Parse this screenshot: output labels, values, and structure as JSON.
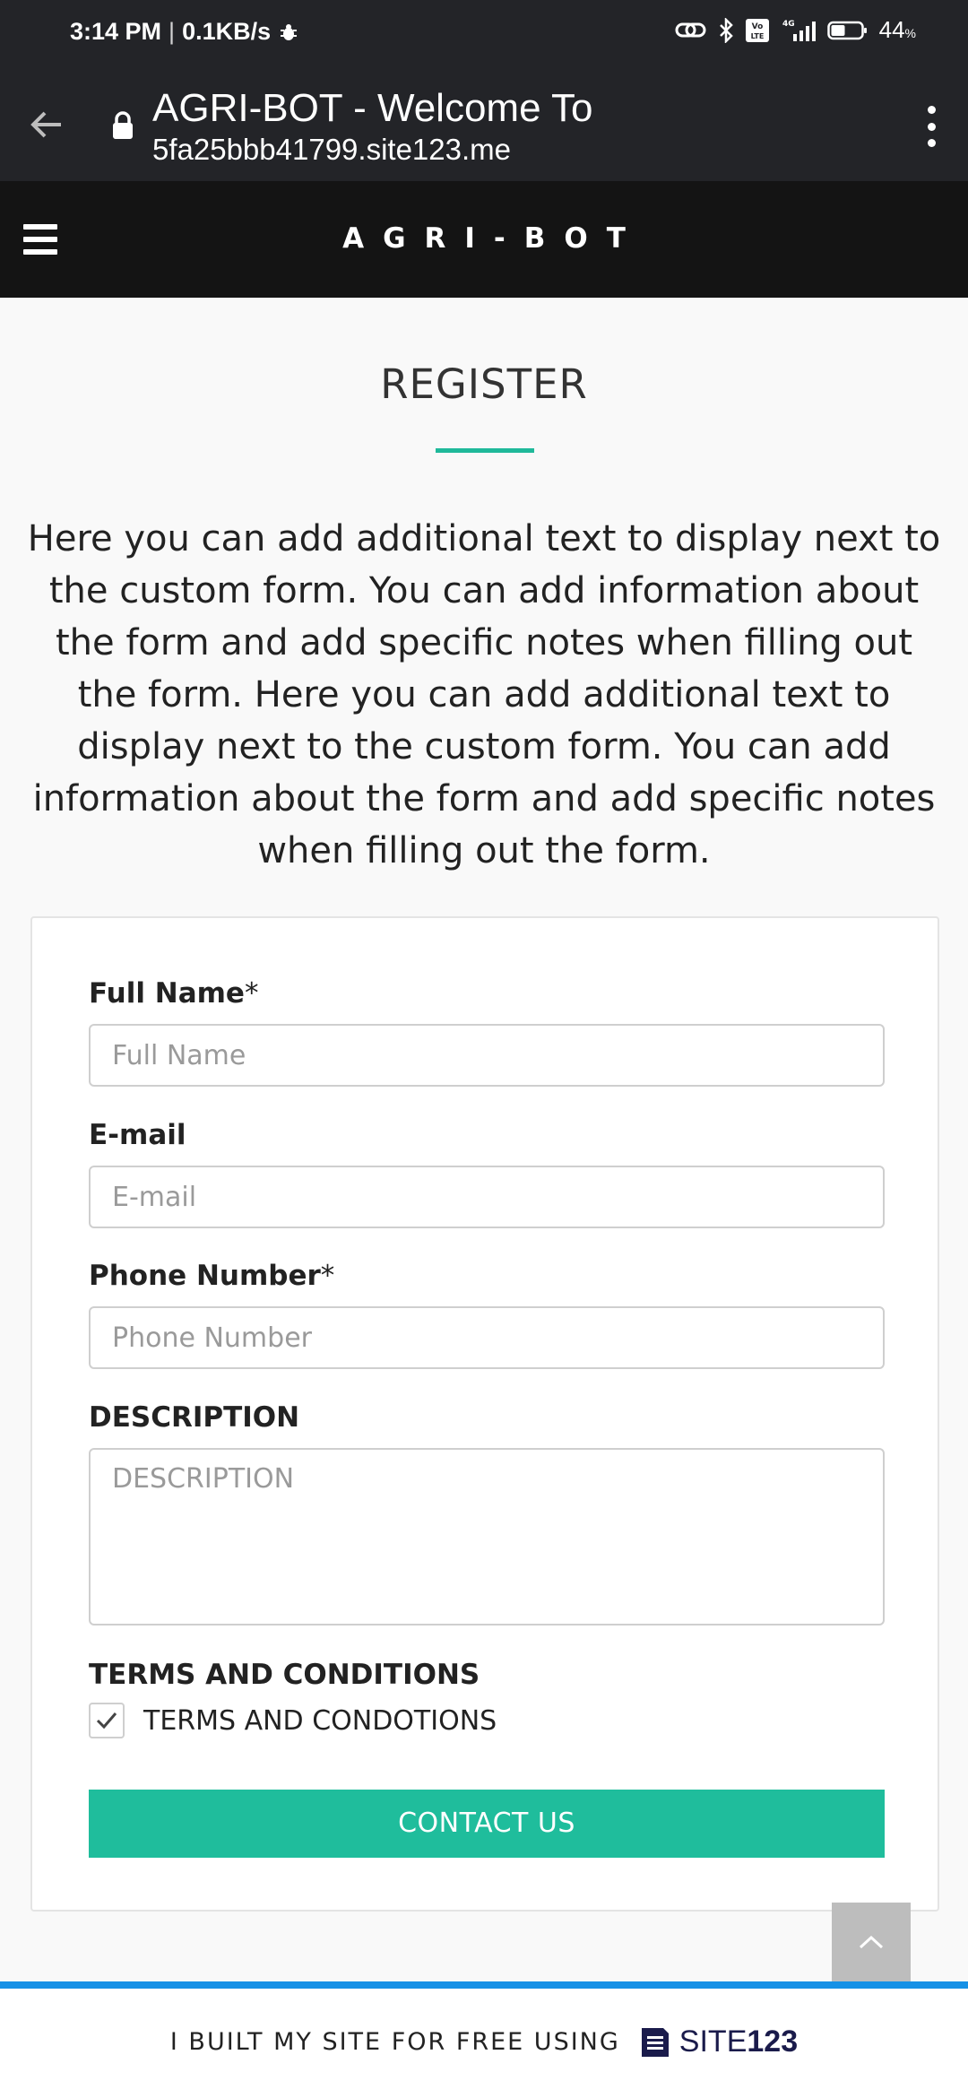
{
  "status_bar": {
    "time": "3:14 PM",
    "speed": "0.1KB/s",
    "network": "4G",
    "volte": "Vo LTE",
    "battery_level": "44",
    "battery_unit": "%"
  },
  "browser": {
    "page_title": "AGRI-BOT - Welcome To",
    "host": "5fa25bbb41799.site123.me"
  },
  "site": {
    "logo": "AGRI-BOT"
  },
  "main": {
    "title": "REGISTER",
    "intro": "Here you can add additional text to display next to the custom form. You can add information about the form and add specific notes when filling out the form. Here you can add additional text to display next to the custom form. You can add information about the form and add specific notes when filling out the form."
  },
  "form": {
    "full_name": {
      "label": "Full Name",
      "required_mark": "*",
      "placeholder": "Full Name"
    },
    "email": {
      "label": "E-mail",
      "placeholder": "E-mail"
    },
    "phone": {
      "label": "Phone Number",
      "required_mark": "*",
      "placeholder": "Phone Number"
    },
    "description": {
      "label": "DESCRIPTION",
      "placeholder": "DESCRIPTION"
    },
    "terms": {
      "heading": "TERMS AND CONDITIONS",
      "checkbox_label": "TERMS AND CONDOTIONS",
      "checked": true
    },
    "submit_label": "CONTACT US"
  },
  "footer": {
    "text": "I BUILT MY SITE FOR FREE USING",
    "brand_a": "SITE",
    "brand_b": "123"
  },
  "colors": {
    "accent": "#1fbd9c",
    "header_bg": "#141414",
    "browser_bg": "#232428",
    "footer_rule": "#1591e6"
  }
}
